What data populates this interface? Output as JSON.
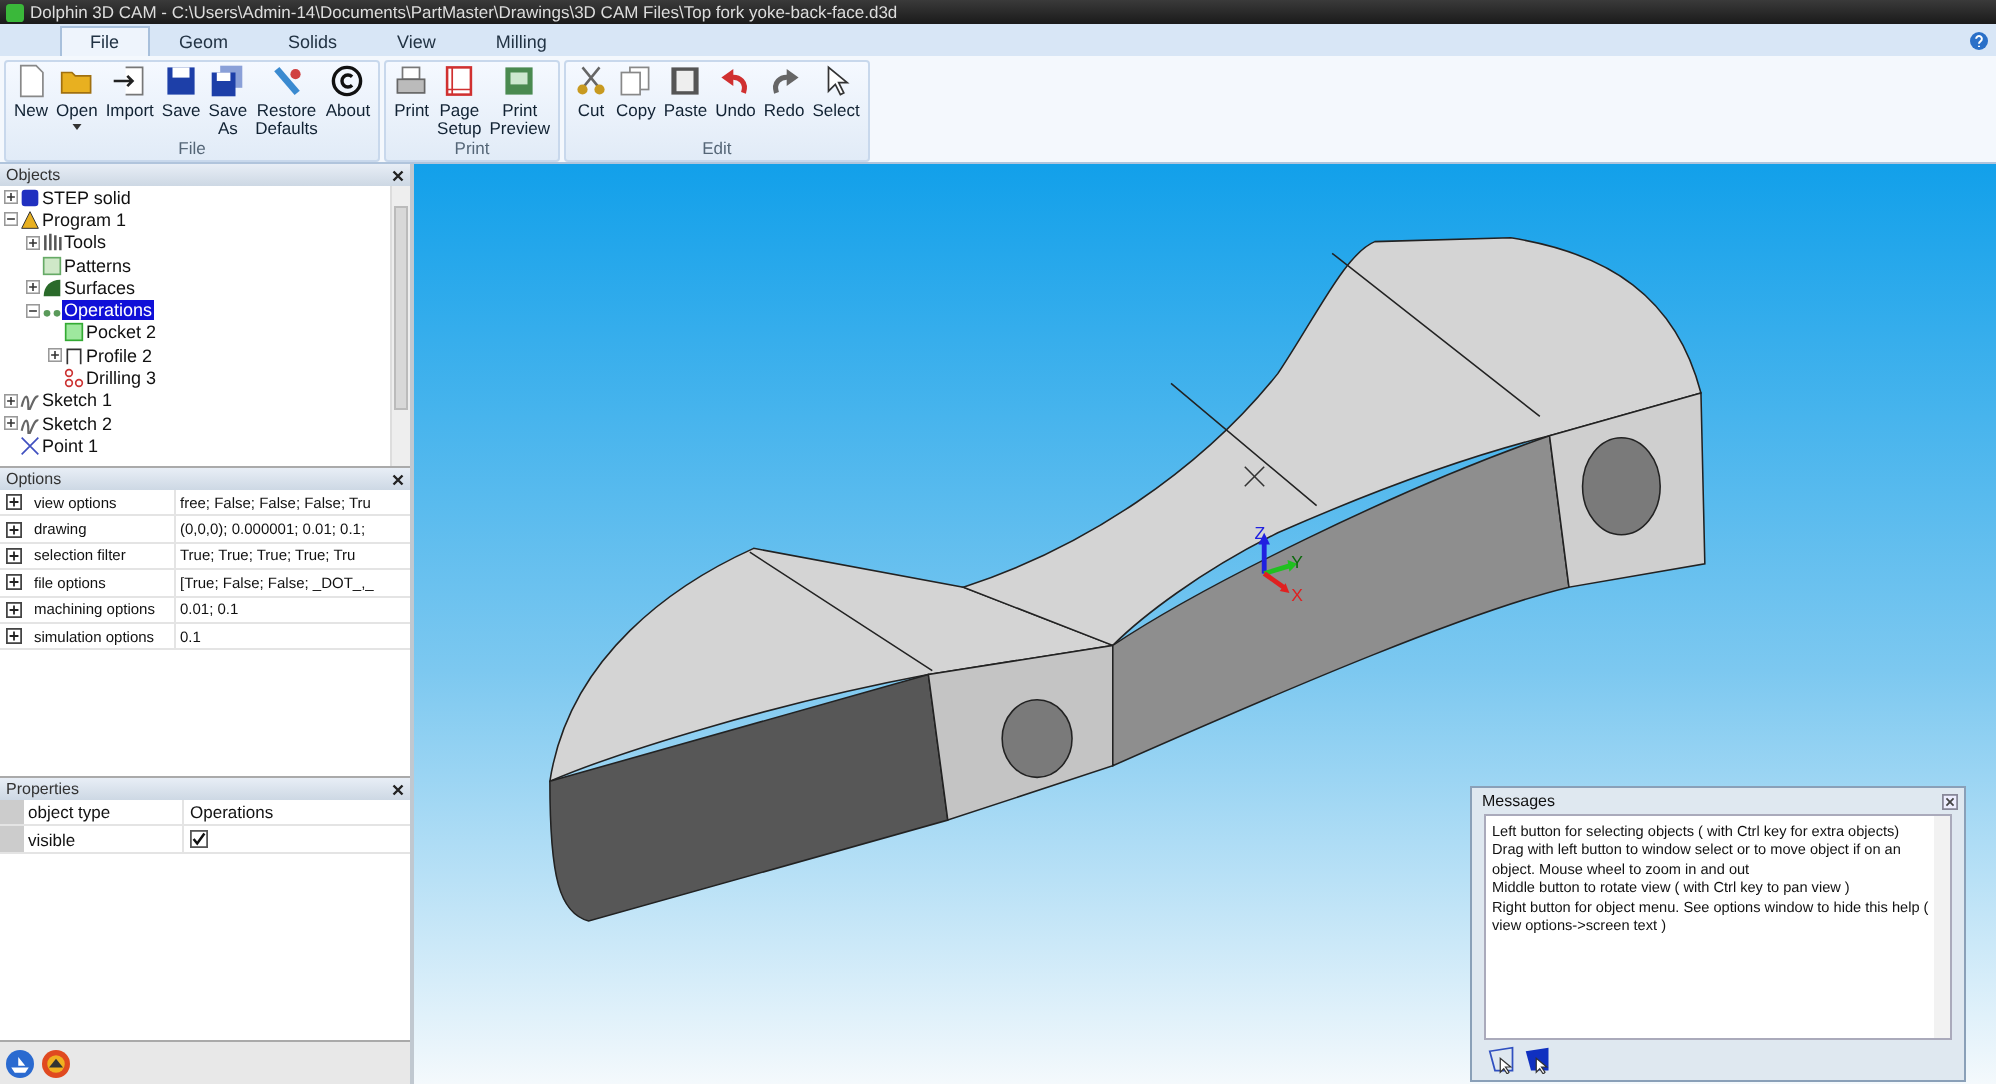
{
  "window": {
    "title": "Dolphin 3D CAM - C:\\Users\\Admin-14\\Documents\\PartMaster\\Drawings\\3D CAM Files\\Top fork yoke-back-face.d3d"
  },
  "tabs": [
    {
      "label": "File",
      "selected": true
    },
    {
      "label": "Geom",
      "selected": false
    },
    {
      "label": "Solids",
      "selected": false
    },
    {
      "label": "View",
      "selected": false
    },
    {
      "label": "Milling",
      "selected": false
    }
  ],
  "ribbon": [
    {
      "label": "File",
      "buttons": [
        {
          "label": "New",
          "dropdown": false
        },
        {
          "label": "Open",
          "dropdown": true
        },
        {
          "label": "Import",
          "dropdown": false
        },
        {
          "label": "Save",
          "dropdown": false
        },
        {
          "label": "Save\nAs",
          "dropdown": false
        },
        {
          "label": "Restore\nDefaults",
          "dropdown": false
        },
        {
          "label": "About",
          "dropdown": false
        }
      ]
    },
    {
      "label": "Print",
      "buttons": [
        {
          "label": "Print",
          "dropdown": false
        },
        {
          "label": "Page\nSetup",
          "dropdown": false
        },
        {
          "label": "Print\nPreview",
          "dropdown": false
        }
      ]
    },
    {
      "label": "Edit",
      "buttons": [
        {
          "label": "Cut",
          "dropdown": false
        },
        {
          "label": "Copy",
          "dropdown": false
        },
        {
          "label": "Paste",
          "dropdown": false
        },
        {
          "label": "Undo",
          "dropdown": false
        },
        {
          "label": "Redo",
          "dropdown": false
        },
        {
          "label": "Select",
          "dropdown": false
        }
      ]
    }
  ],
  "objects": {
    "title": "Objects",
    "items": [
      {
        "label": "STEP solid",
        "expanded": false,
        "selected": false
      },
      {
        "label": "Program 1",
        "expanded": true,
        "selected": false,
        "children": [
          {
            "label": "Tools",
            "expanded": false,
            "selected": false
          },
          {
            "label": "Patterns",
            "selected": false
          },
          {
            "label": "Surfaces",
            "expanded": false,
            "selected": false
          },
          {
            "label": "Operations",
            "expanded": true,
            "selected": true,
            "children": [
              {
                "label": "Pocket 2",
                "selected": false
              },
              {
                "label": "Profile 2",
                "expanded": false,
                "selected": false
              },
              {
                "label": "Drilling 3",
                "selected": false
              }
            ]
          }
        ]
      },
      {
        "label": "Sketch 1",
        "expanded": false,
        "selected": false
      },
      {
        "label": "Sketch 2",
        "expanded": false,
        "selected": false
      },
      {
        "label": "Point 1",
        "selected": false
      }
    ]
  },
  "options": {
    "title": "Options",
    "rows": [
      {
        "name": "view options",
        "value": "free; False; False; False; Tru"
      },
      {
        "name": "drawing",
        "value": "(0,0,0); 0.000001; 0.01; 0.1;"
      },
      {
        "name": "selection filter",
        "value": "True; True; True; True; Tru"
      },
      {
        "name": "file options",
        "value": "[True; False; False; _DOT_,_"
      },
      {
        "name": "machining options",
        "value": "0.01; 0.1"
      },
      {
        "name": "simulation options",
        "value": "0.1"
      }
    ]
  },
  "properties": {
    "title": "Properties",
    "rows": [
      {
        "kind": "text",
        "name": "object type",
        "value": "Operations"
      },
      {
        "kind": "checkbox",
        "name": "visible",
        "checked": true
      }
    ]
  },
  "viewport": {
    "axes": [
      "Z",
      "Y",
      "X"
    ]
  },
  "messages": {
    "title": "Messages",
    "lines": [
      "Left button for selecting objects ( with Ctrl key for extra objects)",
      "Drag with left button to window select or to move object if on an object. Mouse wheel to zoom in and out",
      "Middle button to rotate view ( with Ctrl key to pan view )",
      "Right button for object menu. See options window to hide this help ( view options->screen text )"
    ]
  }
}
